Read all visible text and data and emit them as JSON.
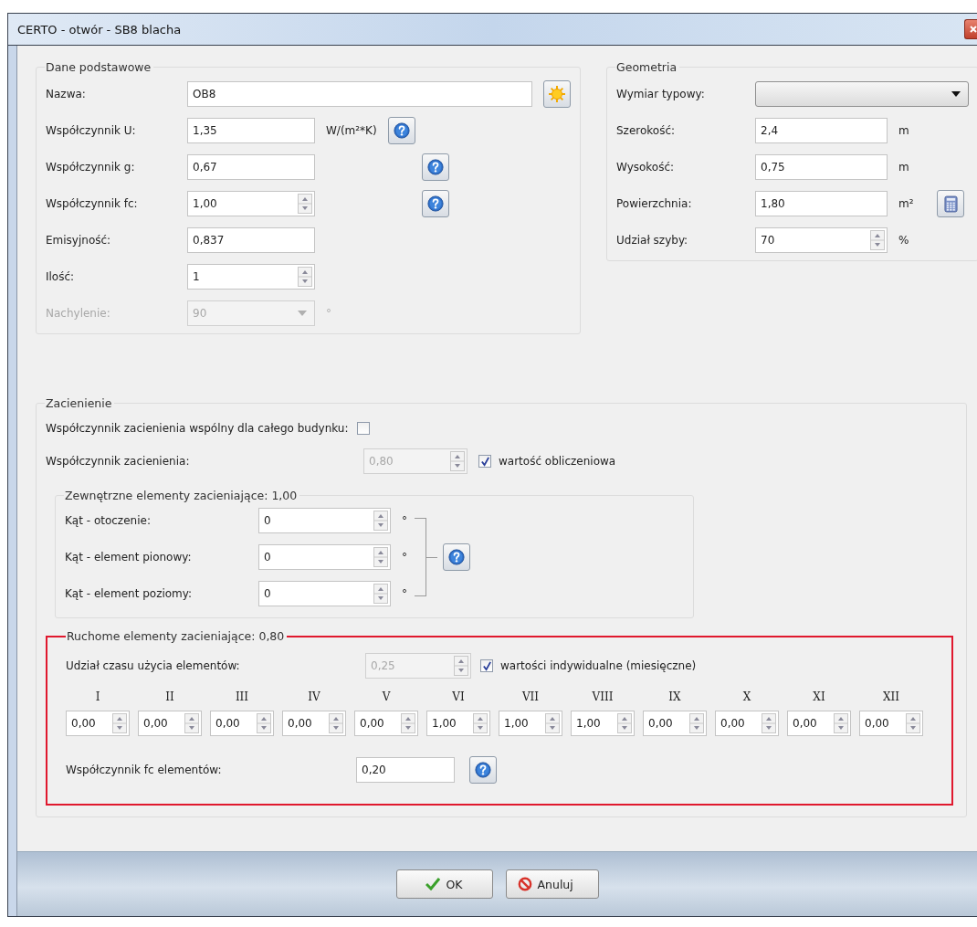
{
  "window": {
    "title": "CERTO - otwór - SB8 blacha"
  },
  "basic": {
    "title": "Dane podstawowe",
    "rows": [
      {
        "label": "Nazwa:",
        "field": {
          "kind": "wide-text",
          "value": "OB8",
          "disabled": false
        },
        "button": {
          "kind": "sun"
        }
      },
      {
        "label": "Współczynnik U:",
        "field": {
          "kind": "text",
          "value": "1,35",
          "disabled": false
        },
        "unit": "W/(m²*K)",
        "button": {
          "kind": "help"
        }
      },
      {
        "label": "Współczynnik g:",
        "field": {
          "kind": "text",
          "value": "0,67",
          "disabled": false
        },
        "button": {
          "kind": "help"
        }
      },
      {
        "label": "Współczynnik fc:",
        "field": {
          "kind": "spin",
          "value": "1,00",
          "disabled": false
        },
        "button": {
          "kind": "help"
        }
      },
      {
        "label": "Emisyjność:",
        "field": {
          "kind": "text",
          "value": "0,837",
          "disabled": false
        }
      },
      {
        "label": "Ilość:",
        "field": {
          "kind": "spin",
          "value": "1",
          "disabled": false
        }
      },
      {
        "label": "Nachylenie:",
        "field": {
          "kind": "combo",
          "value": "90",
          "disabled": true
        },
        "unit": "°"
      }
    ]
  },
  "geometry": {
    "title": "Geometria",
    "rows": [
      {
        "label": "Wymiar typowy:",
        "field": {
          "kind": "wide-combo"
        }
      },
      {
        "label": "Szerokość:",
        "field": {
          "kind": "text",
          "value": "2,4"
        },
        "unit": "m"
      },
      {
        "label": "Wysokość:",
        "field": {
          "kind": "text",
          "value": "0,75"
        },
        "unit": "m"
      },
      {
        "label": "Powierzchnia:",
        "field": {
          "kind": "text",
          "value": "1,80"
        },
        "unit": "m²",
        "button": {
          "kind": "calculator"
        }
      },
      {
        "label": "Udział szyby:",
        "field": {
          "kind": "spin",
          "value": "70"
        },
        "unit": "%"
      }
    ]
  },
  "shading": {
    "title": "Zacienienie",
    "common": {
      "label": "Współczynnik zacienienia wspólny dla całego budynku:",
      "checked": false
    },
    "factor": {
      "label": "Współczynnik zacienienia:",
      "field": {
        "kind": "spin",
        "value": "0,80",
        "disabled": true
      },
      "option": {
        "label": "wartość obliczeniowa",
        "checked": true
      }
    },
    "external": {
      "title": "Zewnętrzne elementy zacieniające: 1,00",
      "button": {
        "kind": "help"
      },
      "rows": [
        {
          "label": "Kąt - otoczenie:",
          "field": {
            "kind": "spin",
            "value": "0"
          },
          "unit": "°"
        },
        {
          "label": "Kąt - element pionowy:",
          "field": {
            "kind": "spin",
            "value": "0"
          },
          "unit": "°"
        },
        {
          "label": "Kąt - element poziomy:",
          "field": {
            "kind": "spin",
            "value": "0"
          },
          "unit": "°"
        }
      ]
    },
    "movable": {
      "title": "Ruchome elementy zacieniające: 0,80",
      "highlighted": true,
      "usage": {
        "label": "Udział czasu użycia elementów:",
        "field": {
          "kind": "spin",
          "value": "0,25",
          "disabled": true
        },
        "option": {
          "label": "wartości indywidualne (miesięczne)",
          "checked": true
        }
      },
      "months": [
        {
          "label": "I",
          "field": {
            "kind": "spin",
            "value": "0,00"
          }
        },
        {
          "label": "II",
          "field": {
            "kind": "spin",
            "value": "0,00"
          }
        },
        {
          "label": "III",
          "field": {
            "kind": "spin",
            "value": "0,00"
          }
        },
        {
          "label": "IV",
          "field": {
            "kind": "spin",
            "value": "0,00"
          }
        },
        {
          "label": "V",
          "field": {
            "kind": "spin",
            "value": "0,00"
          }
        },
        {
          "label": "VI",
          "field": {
            "kind": "spin",
            "value": "1,00"
          }
        },
        {
          "label": "VII",
          "field": {
            "kind": "spin",
            "value": "1,00"
          }
        },
        {
          "label": "VIII",
          "field": {
            "kind": "spin",
            "value": "1,00"
          }
        },
        {
          "label": "IX",
          "field": {
            "kind": "spin",
            "value": "0,00"
          }
        },
        {
          "label": "X",
          "field": {
            "kind": "spin",
            "value": "0,00"
          }
        },
        {
          "label": "XI",
          "field": {
            "kind": "spin",
            "value": "0,00"
          }
        },
        {
          "label": "XII",
          "field": {
            "kind": "spin",
            "value": "0,00"
          }
        }
      ],
      "fc": {
        "label": "Współczynnik fc elementów:",
        "field": {
          "kind": "text",
          "value": "0,20"
        },
        "button": {
          "kind": "help"
        }
      }
    }
  },
  "buttons": [
    {
      "kind": "ok",
      "label": "OK"
    },
    {
      "kind": "cancel",
      "label": "Anuluj"
    }
  ]
}
